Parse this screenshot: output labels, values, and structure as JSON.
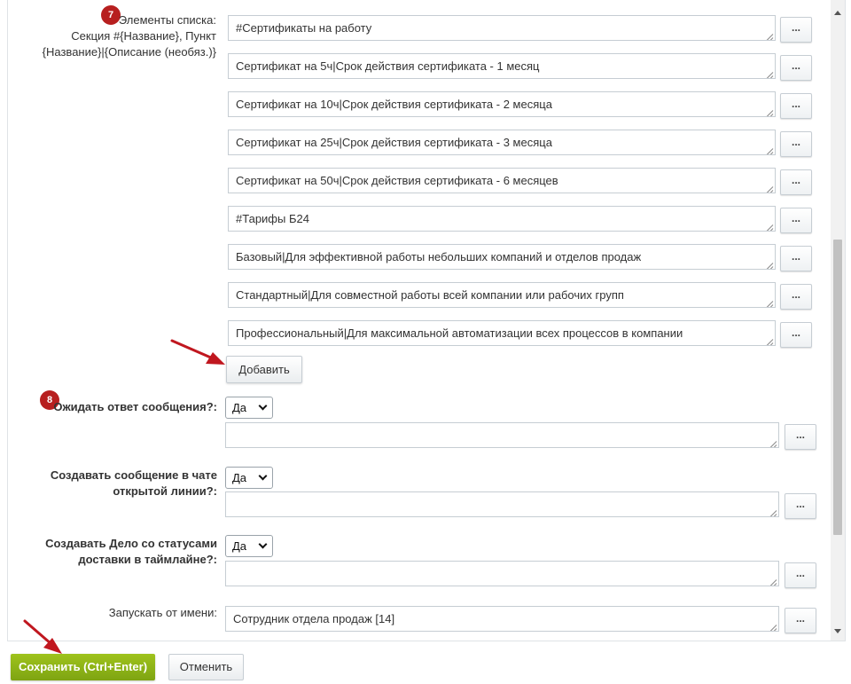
{
  "list_field": {
    "badge": "7",
    "label_line1": "Элементы списка:",
    "label_line2": "Секция #{Название}, Пункт",
    "label_line3": "{Название}|{Описание (необяз.)}",
    "items": [
      "#Сертификаты на работу",
      "Сертификат на 5ч|Срок действия сертификата - 1 месяц",
      "Сертификат на 10ч|Срок действия сертификата - 2 месяца",
      "Сертификат на 25ч|Срок действия сертификата - 3 месяца",
      "Сертификат на 50ч|Срок действия сертификата - 6 месяцев",
      "#Тарифы Б24",
      "Базовый|Для эффективной работы небольших компаний и отделов продаж",
      "Стандартный|Для совместной работы всей компании или рабочих групп",
      "Профессиональный|Для максимальной автоматизации всех процессов в компании"
    ],
    "dots_label": "...",
    "add_label": "Добавить"
  },
  "wait_field": {
    "badge": "8",
    "label": "Ожидать ответ сообщения?:",
    "select_value": "Да",
    "text_value": "",
    "dots_label": "..."
  },
  "chat_field": {
    "label_line1": "Создавать сообщение в чате",
    "label_line2": "открытой линии?:",
    "select_value": "Да",
    "text_value": "",
    "dots_label": "..."
  },
  "deal_field": {
    "label_line1": "Создавать Дело со статусами",
    "label_line2": "доставки в таймлайне?:",
    "select_value": "Да",
    "text_value": "",
    "dots_label": "..."
  },
  "run_as_field": {
    "label": "Запускать от имени:",
    "text_value": "Сотрудник отдела продаж [14]",
    "dots_label": "..."
  },
  "footer": {
    "save_label": "Сохранить (Ctrl+Enter)",
    "cancel_label": "Отменить"
  },
  "colors": {
    "accent_green": "#8db41a",
    "badge_red": "#b71f1f",
    "arrow_red": "#c0171f"
  },
  "icons": [
    "resize-grip-icon",
    "chevron-down-icon",
    "scroll-up-arrow-icon",
    "scroll-down-arrow-icon",
    "annotation-arrow-icon"
  ]
}
